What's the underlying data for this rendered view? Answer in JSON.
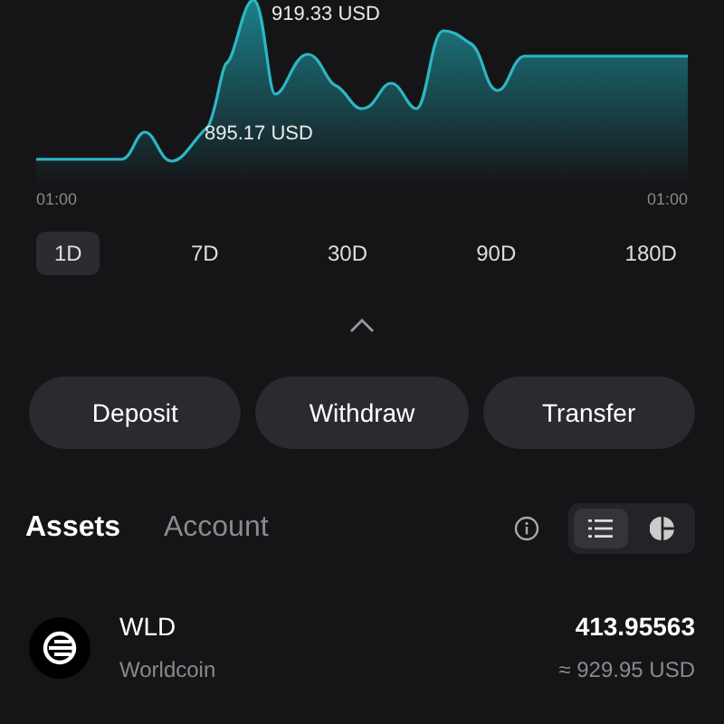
{
  "chart": {
    "high_label": "919.33 USD",
    "low_label": "895.17 USD",
    "axis_labels": [
      "01:00",
      "01:00"
    ]
  },
  "periods": [
    {
      "label": "1D",
      "selected": true
    },
    {
      "label": "7D",
      "selected": false
    },
    {
      "label": "30D",
      "selected": false
    },
    {
      "label": "90D",
      "selected": false
    },
    {
      "label": "180D",
      "selected": false
    }
  ],
  "actions": [
    "Deposit",
    "Withdraw",
    "Transfer"
  ],
  "tabs": [
    {
      "label": "Assets",
      "selected": true
    },
    {
      "label": "Account",
      "selected": false
    }
  ],
  "view_toggle": [
    {
      "kind": "list",
      "selected": true
    },
    {
      "kind": "pie",
      "selected": false
    }
  ],
  "assets": [
    {
      "symbol": "WLD",
      "name": "Worldcoin",
      "amount": "413.95563",
      "value": "≈ 929.95 USD"
    }
  ]
}
